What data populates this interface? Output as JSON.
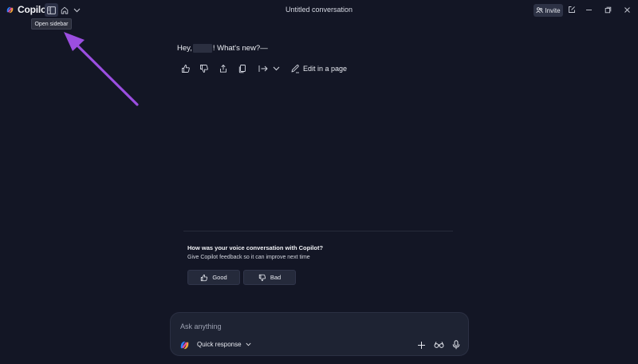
{
  "app": {
    "name": "Copilot"
  },
  "window": {
    "title": "Untitled conversation"
  },
  "header": {
    "invite_label": "Invite"
  },
  "tooltip": {
    "text": "Open sidebar"
  },
  "message": {
    "greeting_prefix": "Hey,",
    "greeting_suffix": "! What's new?—",
    "edit_in_page_label": "Edit in a page"
  },
  "feedback": {
    "title": "How was your voice conversation with Copilot?",
    "subtitle": "Give Copilot feedback so it can improve next time",
    "good_label": "Good",
    "bad_label": "Bad"
  },
  "composer": {
    "placeholder": "Ask anything",
    "mode_label": "Quick response"
  },
  "colors": {
    "background": "#131625",
    "annotation_arrow": "#9b4ee0",
    "composer_bg": "#1e2333"
  }
}
